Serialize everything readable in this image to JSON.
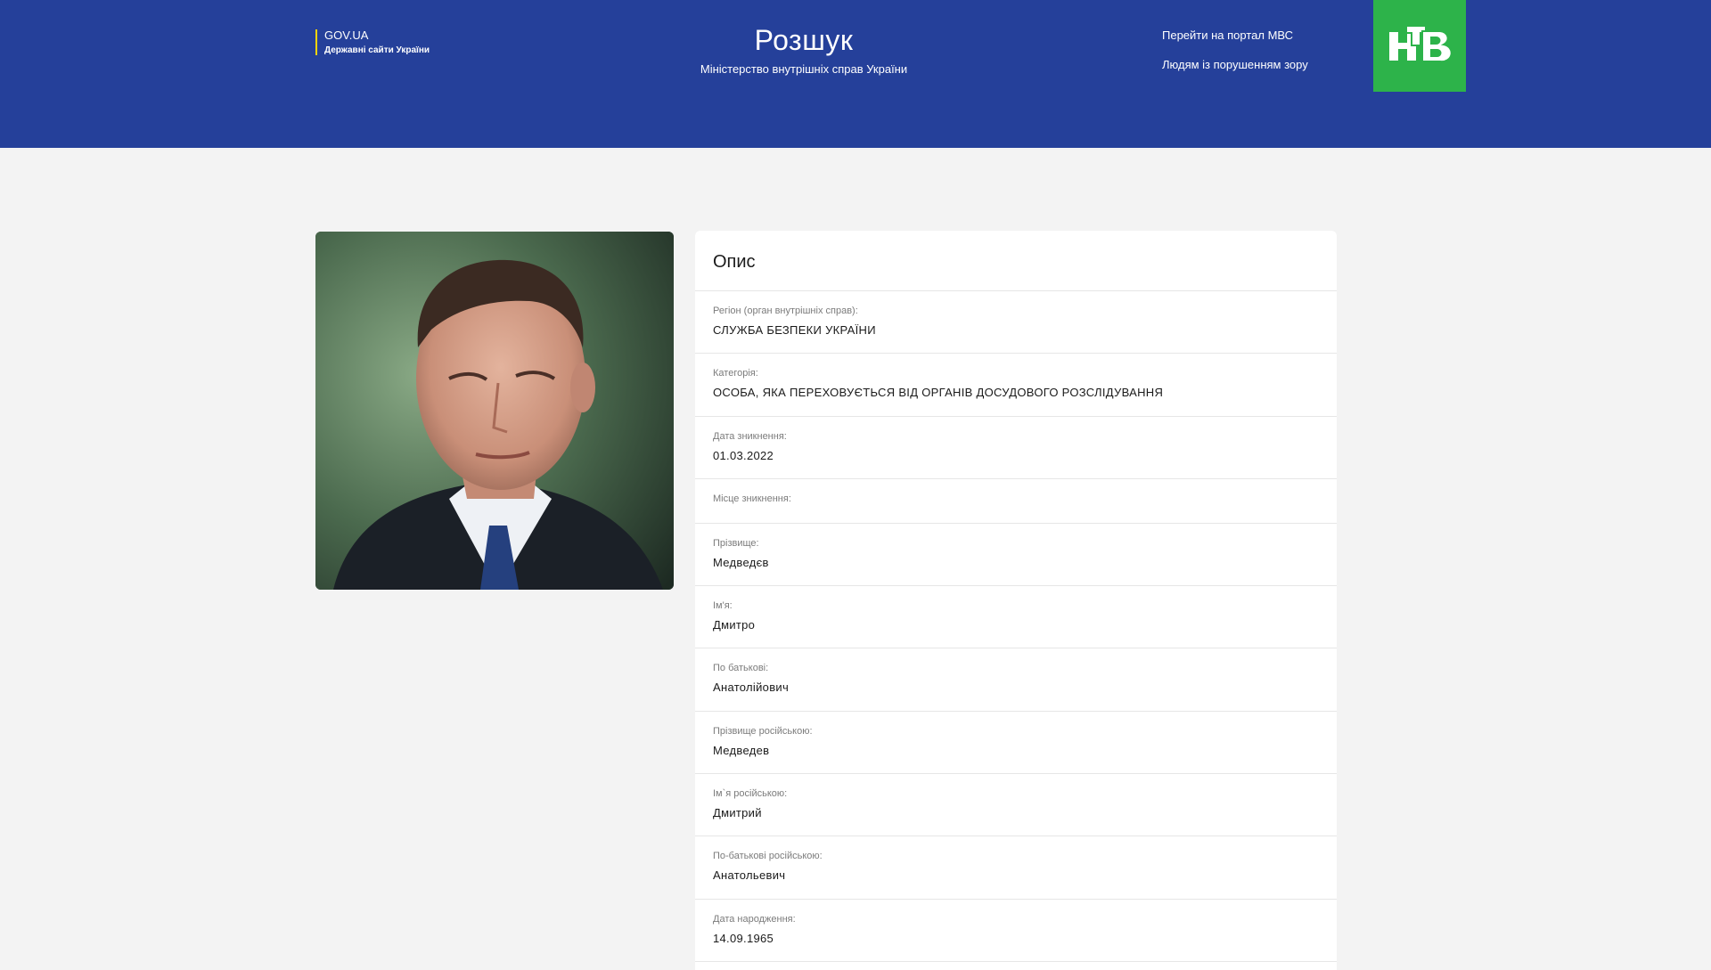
{
  "header": {
    "govua_title": "GOV.UA",
    "govua_subtitle": "Державні сайти України",
    "title": "Розшук",
    "subtitle": "Міністерство внутрішніх справ України",
    "links": [
      "Перейти на портал МВС",
      "Людям із порушенням зору"
    ],
    "logo_icon": "ntv-logo",
    "logo_color": "#2db34a",
    "header_color": "#25409a"
  },
  "card": {
    "title": "Опис",
    "fields": [
      {
        "label": "Регіон (орган внутрішніх справ):",
        "value": "СЛУЖБА БЕЗПЕКИ УКРАЇНИ"
      },
      {
        "label": "Категорія:",
        "value": "ОСОБА, ЯКА ПЕРЕХОВУЄТЬСЯ ВІД ОРГАНІВ ДОСУДОВОГО РОЗСЛІДУВАННЯ"
      },
      {
        "label": "Дата зникнення:",
        "value": "01.03.2022"
      },
      {
        "label": "Місце зникнення:",
        "value": ""
      },
      {
        "label": "Прізвище:",
        "value": "Медведєв"
      },
      {
        "label": "Ім'я:",
        "value": "Дмитро"
      },
      {
        "label": "По батькові:",
        "value": "Анатолійович"
      },
      {
        "label": "Прізвище російською:",
        "value": "Медведев"
      },
      {
        "label": "Ім`я російською:",
        "value": "Дмитрий"
      },
      {
        "label": "По-батькові російською:",
        "value": "Анатольевич"
      },
      {
        "label": "Дата народження:",
        "value": "14.09.1965"
      }
    ]
  }
}
